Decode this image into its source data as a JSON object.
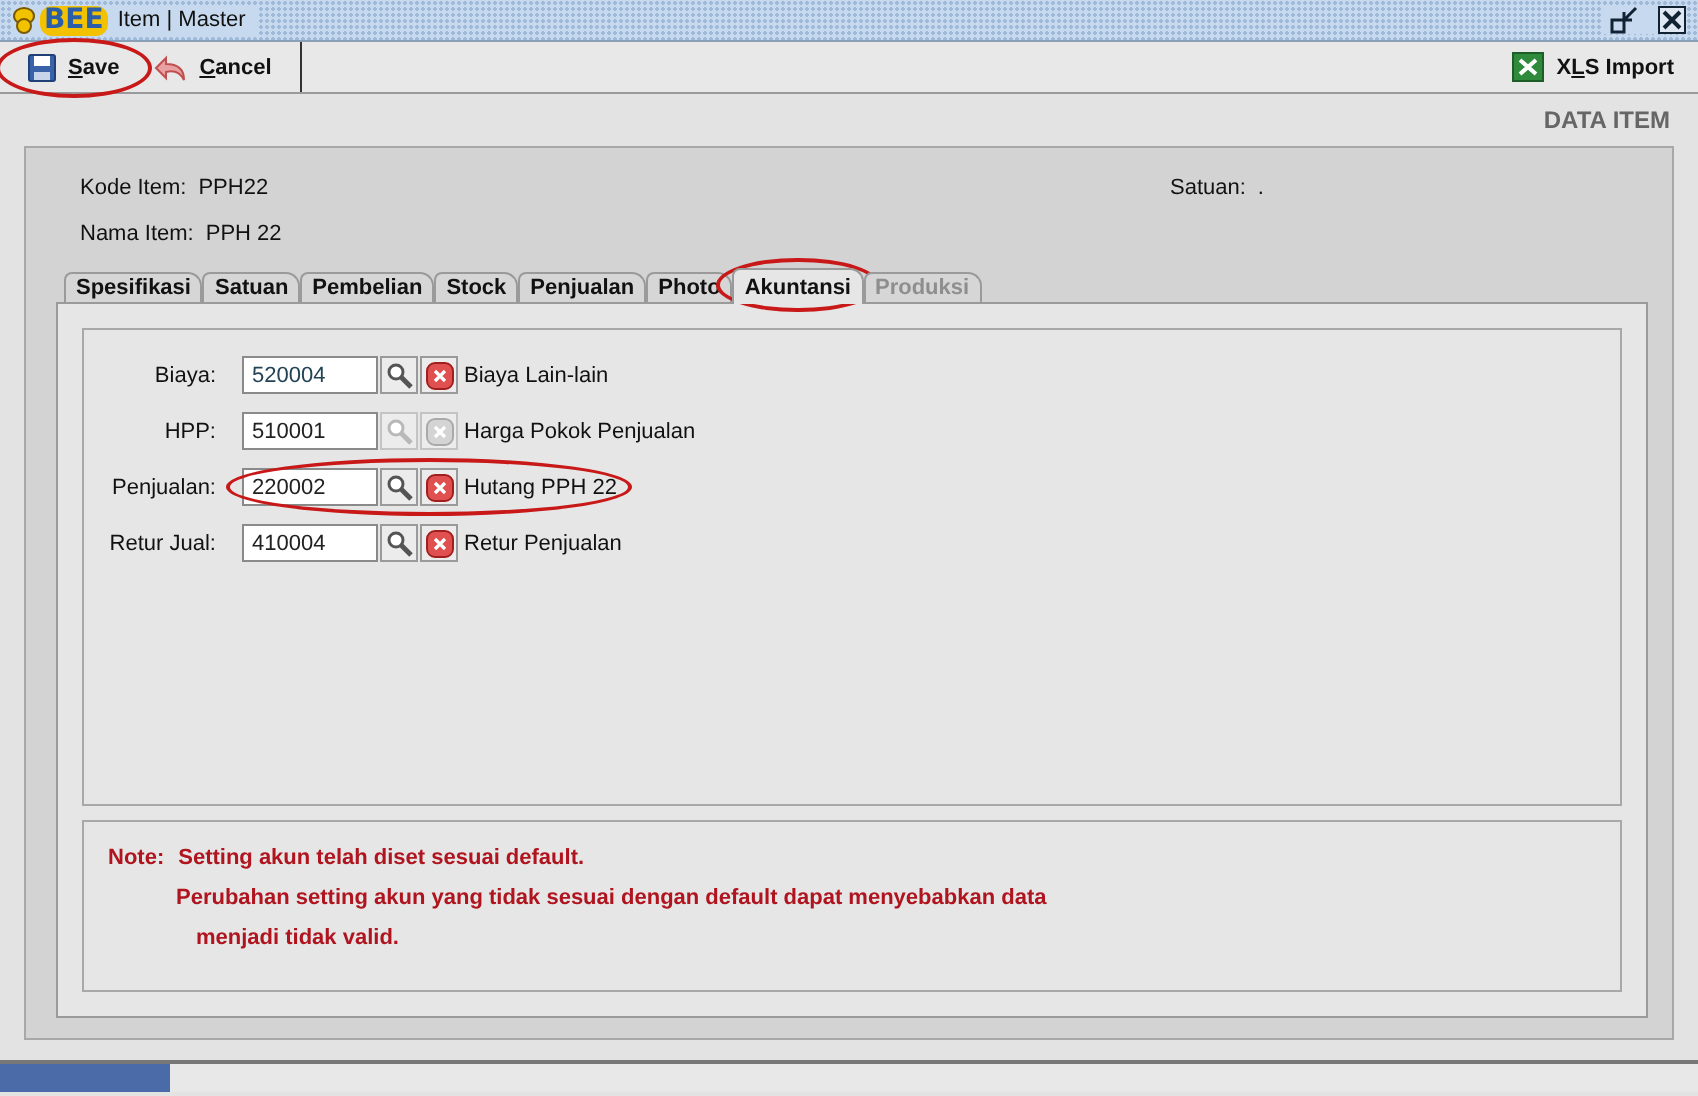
{
  "window": {
    "logo": "BEE",
    "title": "Item | Master"
  },
  "toolbar": {
    "buttons": [
      {
        "label": "Save",
        "circled": true
      },
      {
        "label": "Cancel",
        "circled": false
      }
    ],
    "right_button": {
      "label": "XLS Import"
    }
  },
  "header": "DATA ITEM",
  "item": {
    "fields": [
      {
        "label": "Kode Item:",
        "value": "PPH22"
      },
      {
        "label": "Nama Item:",
        "value": "PPH 22"
      }
    ],
    "unit": {
      "label": "Satuan:",
      "value": "."
    }
  },
  "tabs": [
    {
      "label": "Spesifikasi",
      "selected": false,
      "disabled": false,
      "circled": false
    },
    {
      "label": "Satuan",
      "selected": false,
      "disabled": false,
      "circled": false
    },
    {
      "label": "Pembelian",
      "selected": false,
      "disabled": false,
      "circled": false
    },
    {
      "label": "Stock",
      "selected": false,
      "disabled": false,
      "circled": false
    },
    {
      "label": "Penjualan",
      "selected": false,
      "disabled": false,
      "circled": false
    },
    {
      "label": "Photo",
      "selected": false,
      "disabled": false,
      "circled": false
    },
    {
      "label": "Akuntansi",
      "selected": true,
      "disabled": false,
      "circled": true
    },
    {
      "label": "Produksi",
      "selected": false,
      "disabled": true,
      "circled": false
    }
  ],
  "accounts": [
    {
      "label": "Biaya:",
      "code": "520004",
      "name": "Biaya Lain-lain",
      "highlighted": true,
      "disabled": false,
      "circled": false
    },
    {
      "label": "HPP:",
      "code": "510001",
      "name": "Harga Pokok Penjualan",
      "highlighted": false,
      "disabled": true,
      "circled": false
    },
    {
      "label": "Penjualan:",
      "code": "220002",
      "name": "Hutang PPH 22",
      "highlighted": false,
      "disabled": false,
      "circled": true
    },
    {
      "label": "Retur Jual:",
      "code": "410004",
      "name": "Retur Penjualan",
      "highlighted": false,
      "disabled": false,
      "circled": false
    }
  ],
  "note": {
    "label": "Note:",
    "lines": [
      "Setting akun telah diset sesuai default.",
      "Perubahan setting akun yang tidak sesuai dengan default dapat menyebabkan data",
      "menjadi tidak valid."
    ]
  },
  "status_bar": {
    "level": 0.1
  }
}
